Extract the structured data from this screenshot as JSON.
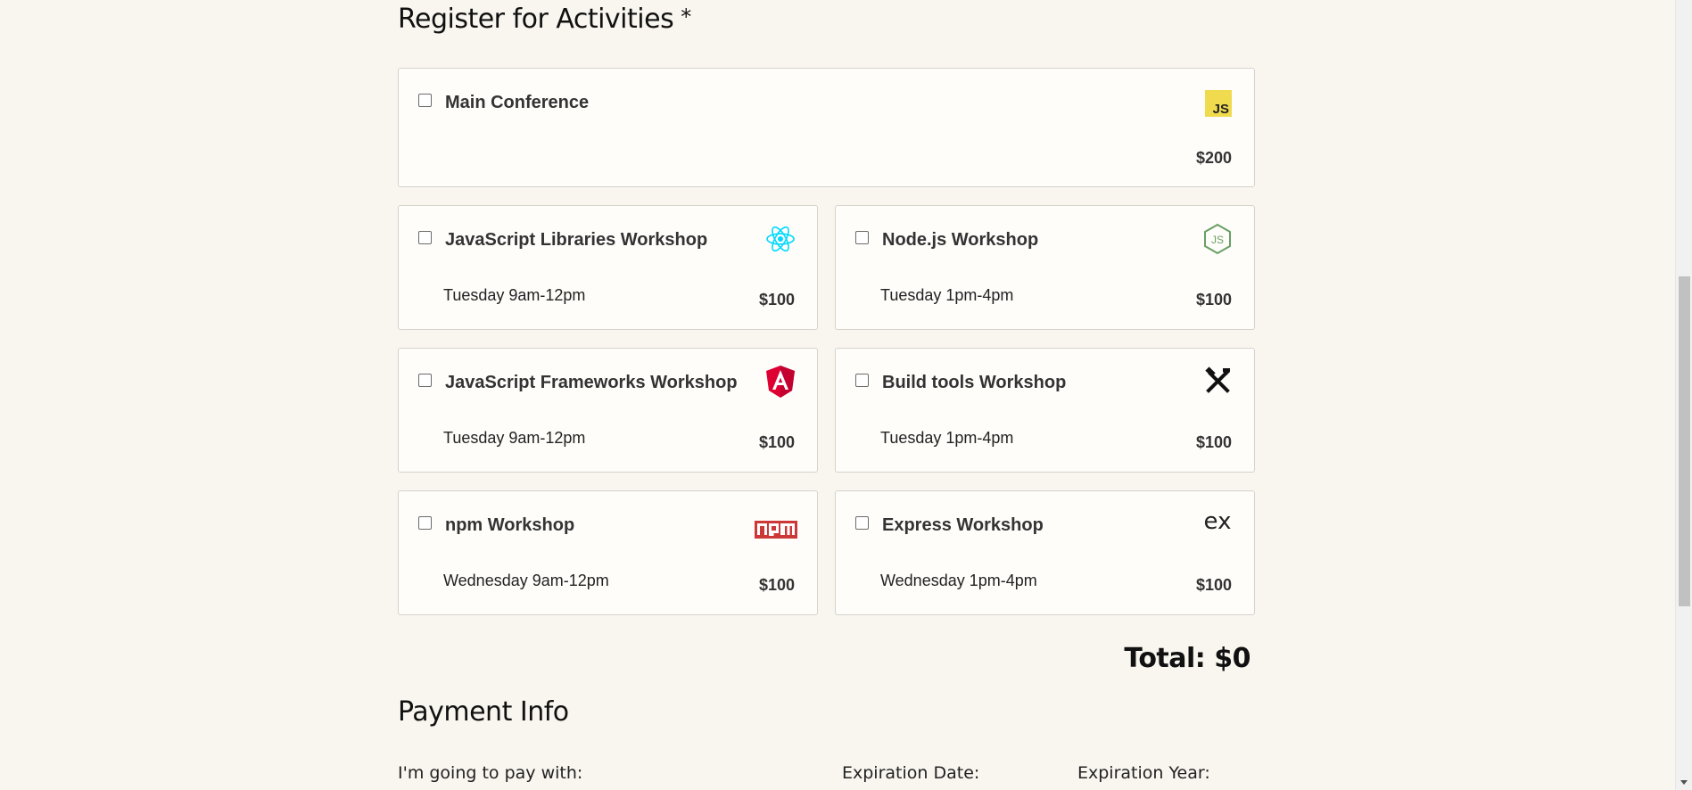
{
  "activities": {
    "title": "Register for Activities",
    "required_mark": "*",
    "main": {
      "name": "Main Conference",
      "price": "$200",
      "icon": "js-icon",
      "icon_text": "JS",
      "icon_color": "#f0db4f"
    },
    "workshops": [
      {
        "name": "JavaScript Libraries Workshop",
        "time": "Tuesday 9am-12pm",
        "price": "$100",
        "icon": "react-icon",
        "icon_color": "#00d8ff"
      },
      {
        "name": "Node.js Workshop",
        "time": "Tuesday 1pm-4pm",
        "price": "$100",
        "icon": "nodejs-icon",
        "icon_color": "#68a063"
      },
      {
        "name": "JavaScript Frameworks Workshop",
        "time": "Tuesday 9am-12pm",
        "price": "$100",
        "icon": "angular-icon",
        "icon_color": "#dd0031"
      },
      {
        "name": "Build tools Workshop",
        "time": "Tuesday 1pm-4pm",
        "price": "$100",
        "icon": "tools-icon",
        "icon_color": "#111111"
      },
      {
        "name": "npm Workshop",
        "time": "Wednesday 9am-12pm",
        "price": "$100",
        "icon": "npm-icon",
        "icon_color": "#cb3837"
      },
      {
        "name": "Express Workshop",
        "time": "Wednesday 1pm-4pm",
        "price": "$100",
        "icon": "express-icon",
        "icon_color": "#222222",
        "icon_text": "ex"
      }
    ],
    "total_label": "Total: $0"
  },
  "payment": {
    "title": "Payment Info",
    "pay_with_label": "I'm going to pay with:",
    "exp_date_label": "Expiration Date:",
    "exp_year_label": "Expiration Year:"
  }
}
